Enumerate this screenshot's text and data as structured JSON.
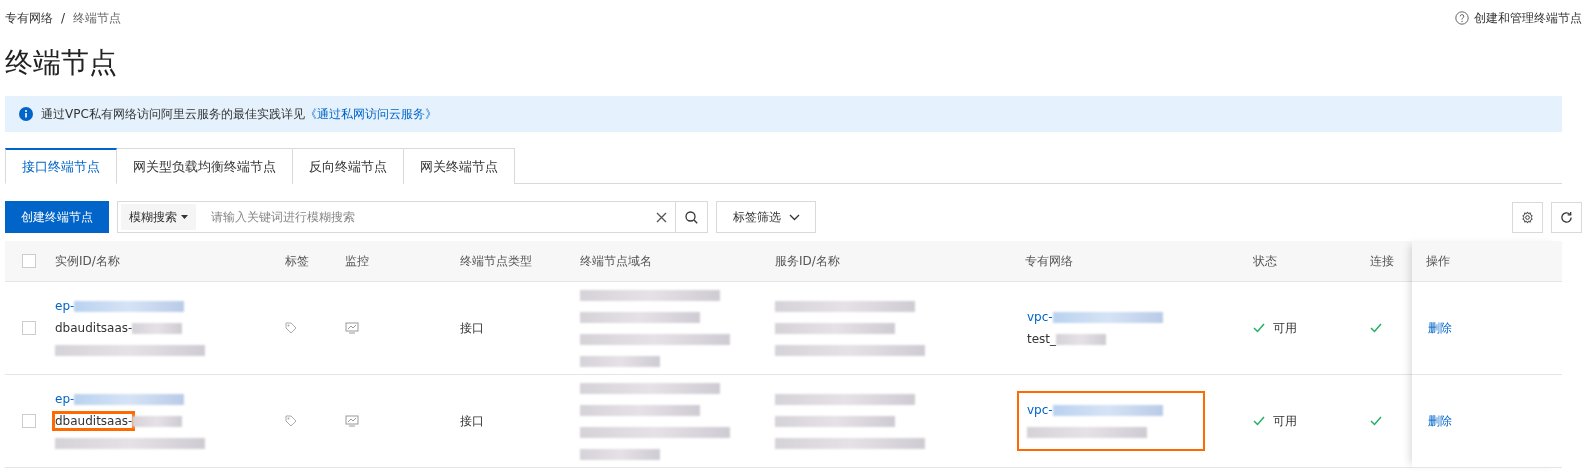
{
  "breadcrumb": {
    "items": [
      "专有网络",
      "终端节点"
    ],
    "separator": "/"
  },
  "help_link": "创建和管理终端节点",
  "title": "终端节点",
  "notice": {
    "text": "通过VPC私有网络访问阿里云服务的最佳实践详见",
    "link": "《通过私网访问云服务》"
  },
  "tabs": [
    {
      "label": "接口终端节点",
      "selected": true
    },
    {
      "label": "网关型负载均衡终端节点",
      "selected": false
    },
    {
      "label": "反向终端节点",
      "selected": false
    },
    {
      "label": "网关终端节点",
      "selected": false
    }
  ],
  "toolbar": {
    "create_button": "创建终端节点",
    "search_mode": "模糊搜索",
    "placeholder": "请输入关键词进行模糊搜索",
    "tag_filter": "标签筛选"
  },
  "table": {
    "select_all_checked": false,
    "columns": [
      "实例ID/名称",
      "标签",
      "监控",
      "终端节点类型",
      "终端节点域名",
      "服务ID/名称",
      "专有网络",
      "状态",
      "连接",
      "操作"
    ],
    "rows": [
      {
        "checked": false,
        "instance": [
          {
            "kind": "link",
            "text": "ep-",
            "blur": true
          },
          {
            "kind": "plain",
            "text": "dbauditsaas-",
            "blur": true,
            "highlighted": false
          },
          {
            "kind": "blur"
          }
        ],
        "type": "接口",
        "domain": [
          {
            "kind": "blur"
          },
          {
            "kind": "blur"
          },
          {
            "kind": "blur"
          },
          {
            "kind": "blur"
          }
        ],
        "service": [
          {
            "kind": "blur"
          },
          {
            "kind": "blur"
          },
          {
            "kind": "blur"
          }
        ],
        "vpc": {
          "highlighted": false,
          "lines": [
            {
              "kind": "link",
              "text": "vpc-",
              "blur": true
            },
            {
              "kind": "plain",
              "text": "test_",
              "blur": true
            }
          ]
        },
        "status": {
          "text": "可用",
          "ok": true
        },
        "connection": {
          "ok": true
        },
        "action": "删除"
      },
      {
        "checked": false,
        "instance": [
          {
            "kind": "link",
            "text": "ep-",
            "blur": true
          },
          {
            "kind": "plain",
            "text": "dbauditsaas-",
            "blur": true,
            "highlighted": true
          },
          {
            "kind": "blur"
          }
        ],
        "type": "接口",
        "domain": [
          {
            "kind": "blur"
          },
          {
            "kind": "blur"
          },
          {
            "kind": "blur"
          },
          {
            "kind": "blur"
          }
        ],
        "service": [
          {
            "kind": "blur"
          },
          {
            "kind": "blur"
          },
          {
            "kind": "blur"
          }
        ],
        "vpc": {
          "highlighted": true,
          "lines": [
            {
              "kind": "link",
              "text": "vpc-",
              "blur": true
            },
            {
              "kind": "blur"
            }
          ]
        },
        "status": {
          "text": "可用",
          "ok": true
        },
        "connection": {
          "ok": true
        },
        "action": "删除"
      }
    ]
  }
}
